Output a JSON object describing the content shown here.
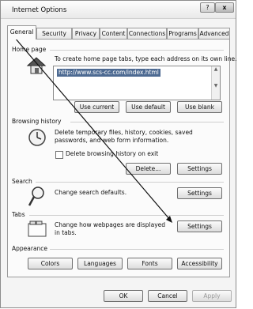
{
  "window": {
    "title": "Internet Options",
    "help_label": "?",
    "close_label": "x"
  },
  "tabs": [
    {
      "label": "General",
      "active": true
    },
    {
      "label": "Security",
      "active": false
    },
    {
      "label": "Privacy",
      "active": false
    },
    {
      "label": "Content",
      "active": false
    },
    {
      "label": "Connections",
      "active": false
    },
    {
      "label": "Programs",
      "active": false
    },
    {
      "label": "Advanced",
      "active": false
    }
  ],
  "home_page": {
    "heading": "Home page",
    "description": "To create home page tabs, type each address on its own line.",
    "url": "http://www.scs-cc.com/index.html",
    "use_current": "Use current",
    "use_default": "Use default",
    "use_blank": "Use blank"
  },
  "browsing_history": {
    "heading": "Browsing history",
    "description": "Delete temporary files, history, cookies, saved passwords, and web form information.",
    "checkbox_label": "Delete browsing history on exit",
    "checkbox_checked": false,
    "delete": "Delete...",
    "settings": "Settings"
  },
  "search": {
    "heading": "Search",
    "description": "Change search defaults.",
    "settings": "Settings"
  },
  "tabs_section": {
    "heading": "Tabs",
    "description": "Change how webpages are displayed in tabs.",
    "settings": "Settings"
  },
  "appearance": {
    "heading": "Appearance",
    "colors": "Colors",
    "languages": "Languages",
    "fonts": "Fonts",
    "accessibility": "Accessibility"
  },
  "footer": {
    "ok": "OK",
    "cancel": "Cancel",
    "apply": "Apply"
  },
  "icons": {
    "home": "house-icon",
    "history": "clock-icon",
    "search": "magnifier-icon",
    "tabs": "tabs-window-icon"
  },
  "colors": {
    "selection": "#4d6a92",
    "pointer_line": "#111111"
  }
}
